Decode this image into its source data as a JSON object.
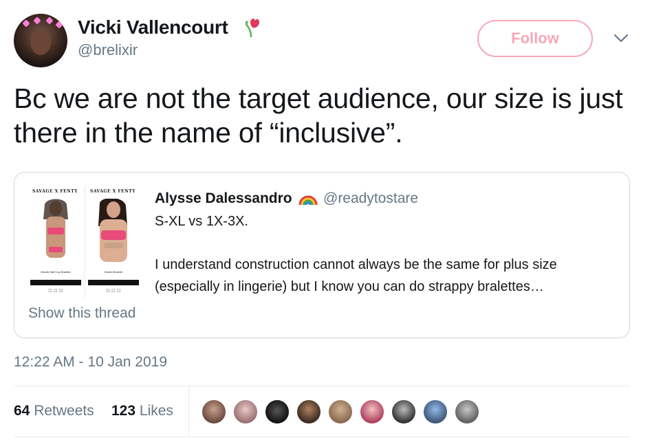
{
  "author": {
    "display_name": "Vicki Vallencourt",
    "handle": "@brelixir",
    "name_emoji": "tulip-emoji"
  },
  "follow_button": {
    "label": "Follow",
    "color": "#f7a8b8"
  },
  "tweet": {
    "text": "Bc we are not the target audience, our size is just there in the name of “inclusive”.",
    "timestamp": "12:22 AM - 10 Jan 2019"
  },
  "quoted_tweet": {
    "display_name": "Alysse Dalessandro",
    "name_emoji": "rainbow-emoji",
    "handle": "@readytostare",
    "line1": "S-XL vs 1X-3X.",
    "body": "I understand construction cannot always be the same for plus size (especially in lingerie) but I know you can do strappy bralettes…",
    "show_thread": "Show this thread",
    "media": {
      "brand": "SAVAGE X FENTY",
      "left_caption": "Hearts Half Cup Bralette",
      "right_caption": "Hearts Bralette",
      "add_button": "ADD TO BAG"
    }
  },
  "stats": {
    "retweets_count": "64",
    "retweets_label": "Retweets",
    "likes_count": "123",
    "likes_label": "Likes"
  },
  "likers_count": 9,
  "colors": {
    "text_primary": "#14171a",
    "text_secondary": "#657786",
    "border": "#ccd6dd"
  }
}
